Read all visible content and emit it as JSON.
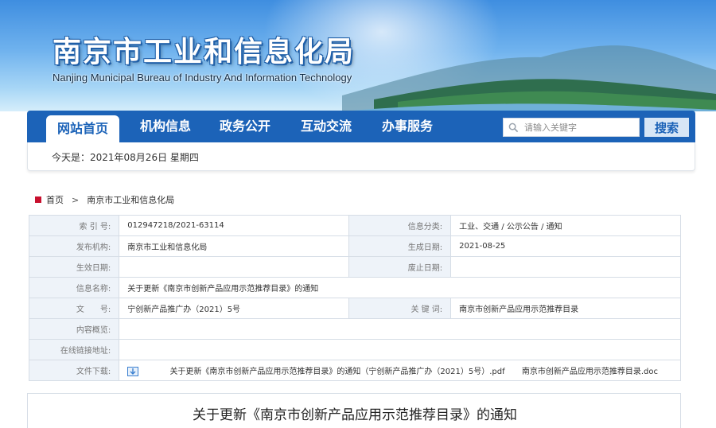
{
  "header": {
    "title": "南京市工业和信息化局",
    "subtitle": "Nanjing Municipal Bureau of Industry And Information Technology"
  },
  "nav": {
    "items": [
      {
        "label": "网站首页",
        "active": true
      },
      {
        "label": "机构信息",
        "active": false
      },
      {
        "label": "政务公开",
        "active": false
      },
      {
        "label": "互动交流",
        "active": false
      },
      {
        "label": "办事服务",
        "active": false
      }
    ],
    "search": {
      "placeholder": "请输入关键字",
      "button_label": "搜索",
      "icon": "search-icon"
    }
  },
  "date_strip": {
    "text": "今天是：2021年08月26日 星期四"
  },
  "breadcrumb": {
    "home": "首页",
    "separator": ">",
    "current": "南京市工业和信息化局"
  },
  "info_table": {
    "index_label": "索 引 号:",
    "index_value": "012947218/2021-63114",
    "category_label": "信息分类:",
    "category_value": "工业、交通 / 公示公告 / 通知",
    "publisher_label": "发布机构:",
    "publisher_value": "南京市工业和信息化局",
    "created_label": "生成日期:",
    "created_value": "2021-08-25",
    "effective_label": "生效日期:",
    "effective_value": "",
    "expire_label": "废止日期:",
    "expire_value": "",
    "name_label": "信息名称:",
    "name_value": "关于更新《南京市创新产品应用示范推荐目录》的通知",
    "docno_label": "文　　号:",
    "docno_value": "宁创新产品推广办（2021）5号",
    "keyword_label": "关 键 词:",
    "keyword_value": "南京市创新产品应用示范推荐目录",
    "overview_label": "内容概览:",
    "overview_value": "",
    "link_label": "在线链接地址:",
    "link_value": "",
    "download_label": "文件下载:",
    "download_icon": "download-icon",
    "file_pdf": "关于更新《南京市创新产品应用示范推荐目录》的通知（宁创新产品推广办（2021）5号）.pdf",
    "file_doc": "南京市创新产品应用示范推荐目录.doc"
  },
  "article": {
    "title": "关于更新《南京市创新产品应用示范推荐目录》的通知"
  },
  "colors": {
    "nav_blue": "#1c63b8",
    "label_bg": "#eef3f9",
    "home_marker": "#c8102e"
  }
}
